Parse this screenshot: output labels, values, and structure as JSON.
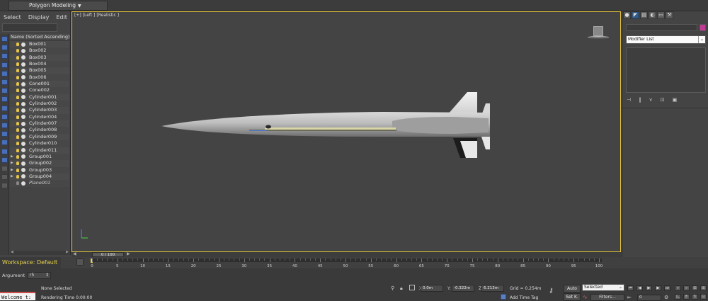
{
  "ribbon": {
    "tab_label": "Polygon Modeling",
    "caret": "▼"
  },
  "explorer": {
    "menu": [
      "Select",
      "Display",
      "Edit"
    ],
    "column_header": "Name (Sorted Ascending)",
    "items": [
      {
        "label": "Box001",
        "expandable": false,
        "frozen": false
      },
      {
        "label": "Box002",
        "expandable": false,
        "frozen": false
      },
      {
        "label": "Box003",
        "expandable": false,
        "frozen": false
      },
      {
        "label": "Box004",
        "expandable": false,
        "frozen": false
      },
      {
        "label": "Box005",
        "expandable": false,
        "frozen": false
      },
      {
        "label": "Box006",
        "expandable": false,
        "frozen": false
      },
      {
        "label": "Cone001",
        "expandable": false,
        "frozen": false
      },
      {
        "label": "Cone002",
        "expandable": false,
        "frozen": false
      },
      {
        "label": "Cylinder001",
        "expandable": false,
        "frozen": false
      },
      {
        "label": "Cylinder002",
        "expandable": false,
        "frozen": false
      },
      {
        "label": "Cylinder003",
        "expandable": false,
        "frozen": false
      },
      {
        "label": "Cylinder004",
        "expandable": false,
        "frozen": false
      },
      {
        "label": "Cylinder007",
        "expandable": false,
        "frozen": false
      },
      {
        "label": "Cylinder008",
        "expandable": false,
        "frozen": false
      },
      {
        "label": "Cylinder009",
        "expandable": false,
        "frozen": false
      },
      {
        "label": "Cylinder010",
        "expandable": false,
        "frozen": false
      },
      {
        "label": "Cylinder011",
        "expandable": false,
        "frozen": false
      },
      {
        "label": "Group001",
        "expandable": true,
        "frozen": false
      },
      {
        "label": "Group002",
        "expandable": true,
        "frozen": false
      },
      {
        "label": "Group003",
        "expandable": true,
        "frozen": false
      },
      {
        "label": "Group004",
        "expandable": true,
        "frozen": false
      },
      {
        "label": "Plane001",
        "expandable": false,
        "frozen": true
      }
    ],
    "toolbar_icons": [
      "select-icon",
      "display-geometry-icon",
      "display-shapes-icon",
      "display-lights-icon",
      "display-cameras-icon",
      "display-helpers-icon",
      "display-spacewarps-icon",
      "display-groups-icon",
      "display-xrefs-icon",
      "display-bones-icon",
      "display-containers-icon",
      "display-frozen-icon",
      "display-hidden-icon",
      "display-all-icon",
      "display-none-icon",
      "invert-display-icon",
      "filter-icon",
      "find-icon"
    ]
  },
  "viewport": {
    "label": "[+] [Left ] [Realistic ]",
    "accent_color": "#e2c23c"
  },
  "timeline": {
    "thumb_label": "0 / 100",
    "workspace_label": "Workspace: Default",
    "ticks": [
      "0",
      "5",
      "10",
      "15",
      "20",
      "25",
      "30",
      "35",
      "40",
      "45",
      "50",
      "55",
      "60",
      "65",
      "70",
      "75",
      "80",
      "85",
      "90",
      "95",
      "100"
    ]
  },
  "status": {
    "argument_label": "Argument",
    "argument_value": "r5",
    "welcome_text": "Welcome t:",
    "selection_text": "None Selected",
    "render_time": "Rendering Time  0:00:00",
    "x_label": "X:",
    "x_value": "0.0m",
    "y_label": "Y:",
    "y_value": "-0.322m",
    "z_label": "Z:",
    "z_value": "6.213m",
    "grid_text": "Grid = 0.254m",
    "add_time_tag": "Add Time Tag",
    "auto_label": "Auto",
    "setk_label": "Set K.",
    "selected_value": "Selected",
    "filters_label": "Filters...",
    "frame_value": "0"
  },
  "command_panel": {
    "tabs": [
      "create-icon",
      "modify-icon",
      "hierarchy-icon",
      "motion-icon",
      "display-icon",
      "utilities-icon"
    ],
    "modifier_list_label": "Modifier List",
    "object_color": "#c33a96"
  }
}
